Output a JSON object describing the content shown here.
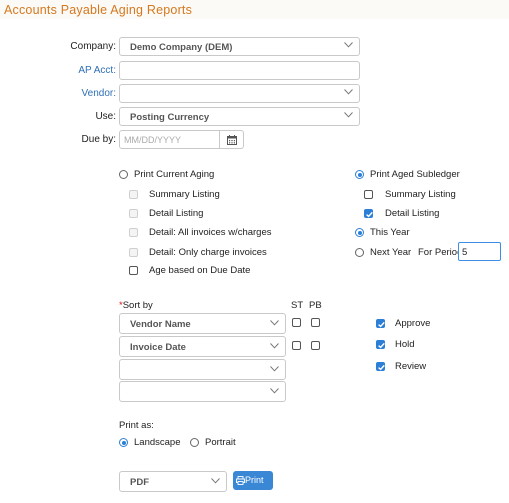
{
  "title": "Accounts Payable Aging Reports",
  "form": {
    "company_label": "Company:",
    "company_value": "Demo Company (DEM)",
    "ap_acct_label": "AP Acct:",
    "vendor_label": "Vendor:",
    "use_label": "Use:",
    "use_value": "Posting Currency",
    "due_by_label": "Due by:",
    "due_by_placeholder": "MM/DD/YYYY"
  },
  "left_options": {
    "print_current_aging": "Print Current Aging",
    "summary_listing": "Summary Listing",
    "detail_listing": "Detail Listing",
    "detail_all_invoices": "Detail: All invoices w/charges",
    "detail_only_charge": "Detail: Only charge invoices",
    "age_based_on_due": "Age based on Due Date"
  },
  "right_options": {
    "print_aged_subledger": "Print Aged Subledger",
    "summary_listing": "Summary Listing",
    "detail_listing": "Detail Listing",
    "this_year": "This Year",
    "next_year": "Next Year",
    "for_period_label": "For Period:",
    "for_period_value": "5"
  },
  "sort": {
    "required_mark": "*",
    "label": "Sort by",
    "st_header": "ST",
    "pb_header": "PB",
    "rows": [
      "Vendor Name",
      "Invoice Date",
      "",
      ""
    ]
  },
  "status_checks": [
    "Approve",
    "Hold",
    "Review"
  ],
  "print_as": {
    "label": "Print as:",
    "landscape": "Landscape",
    "portrait": "Portrait"
  },
  "output": {
    "format_value": "PDF",
    "print_button": "Print"
  },
  "colors": {
    "title": "#d5781e",
    "link_label": "#2f6fb5",
    "accent": "#2b7fd6"
  }
}
